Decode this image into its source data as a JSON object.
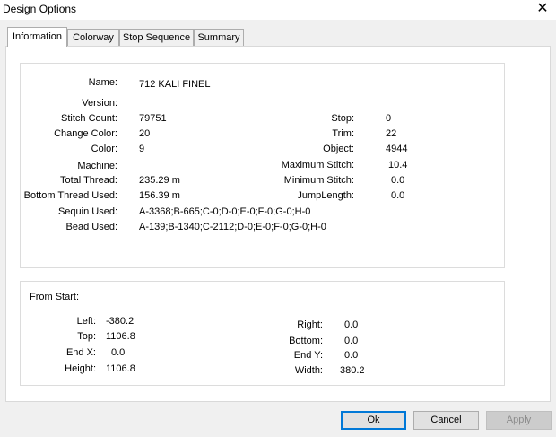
{
  "window": {
    "title": "Design Options",
    "close_glyph": "✕"
  },
  "tabs": [
    "Information",
    "Colorway",
    "Stop Sequence",
    "Summary"
  ],
  "info": {
    "name_label": "Name:",
    "name_value": "712 KALI FINEL",
    "version_label": "Version:",
    "version_value": "",
    "stitch_count_label": "Stitch Count:",
    "stitch_count_value": "79751",
    "change_color_label": "Change Color:",
    "change_color_value": "20",
    "color_label": "Color:",
    "color_value": "9",
    "machine_label": "Machine:",
    "machine_value": "",
    "total_thread_label": "Total Thread:",
    "total_thread_value": "235.29 m",
    "bottom_thread_label": "Bottom Thread Used:",
    "bottom_thread_value": "156.39 m",
    "sequin_label": "Sequin Used:",
    "sequin_value": "A-3368;B-665;C-0;D-0;E-0;F-0;G-0;H-0",
    "bead_label": "Bead Used:",
    "bead_value": "A-139;B-1340;C-2112;D-0;E-0;F-0;G-0;H-0",
    "stop_label": "Stop:",
    "stop_value": "0",
    "trim_label": "Trim:",
    "trim_value": "22",
    "object_label": "Object:",
    "object_value": "4944",
    "max_stitch_label": "Maximum Stitch:",
    "max_stitch_value": "10.4",
    "min_stitch_label": "Minimum Stitch:",
    "min_stitch_value": "0.0",
    "jump_length_label": "JumpLength:",
    "jump_length_value": "0.0"
  },
  "start": {
    "heading": "From Start:",
    "left_label": "Left:",
    "left_value": "-380.2",
    "top_label": "Top:",
    "top_value": "1106.8",
    "endx_label": "End X:",
    "endx_value": "0.0",
    "height_label": "Height:",
    "height_value": "1106.8",
    "right_label": "Right:",
    "right_value": "0.0",
    "bottom_label": "Bottom:",
    "bottom_value": "0.0",
    "endy_label": "End Y:",
    "endy_value": "0.0",
    "width_label": "Width:",
    "width_value": "380.2"
  },
  "buttons": {
    "ok": "Ok",
    "cancel": "Cancel",
    "apply": "Apply"
  }
}
